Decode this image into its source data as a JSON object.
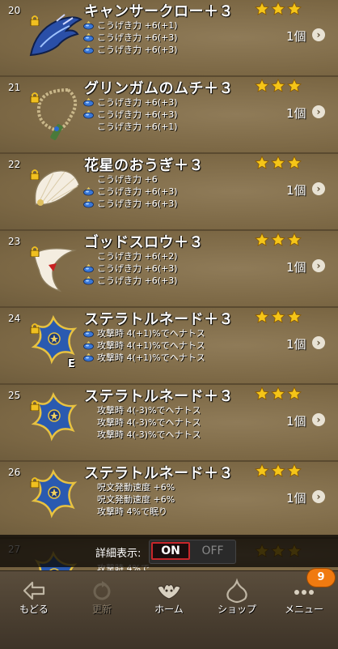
{
  "items": [
    {
      "num": "20",
      "name": "キャンサークロー＋３",
      "qty": "1個",
      "stars": 3,
      "weapon": "claw",
      "stats": [
        {
          "gem": true,
          "text": "こうげき力 +6(+1)"
        },
        {
          "gem": true,
          "text": "こうげき力 +6(+3)"
        },
        {
          "gem": true,
          "text": "こうげき力 +6(+3)"
        }
      ],
      "equipped": false
    },
    {
      "num": "21",
      "name": "グリンガムのムチ＋３",
      "qty": "1個",
      "stars": 3,
      "weapon": "whip",
      "stats": [
        {
          "gem": true,
          "text": "こうげき力 +6(+3)"
        },
        {
          "gem": true,
          "text": "こうげき力 +6(+3)"
        },
        {
          "gem": false,
          "text": "こうげき力 +6(+1)"
        }
      ],
      "equipped": false
    },
    {
      "num": "22",
      "name": "花星のおうぎ＋３",
      "qty": "1個",
      "stars": 3,
      "weapon": "fan",
      "stats": [
        {
          "gem": false,
          "text": "こうげき力 +6"
        },
        {
          "gem": true,
          "text": "こうげき力 +6(+3)"
        },
        {
          "gem": true,
          "text": "こうげき力 +6(+3)"
        }
      ],
      "equipped": false
    },
    {
      "num": "23",
      "name": "ゴッドスロウ＋３",
      "qty": "1個",
      "stars": 3,
      "weapon": "boomerang",
      "stats": [
        {
          "gem": false,
          "text": "こうげき力 +6(+2)"
        },
        {
          "gem": true,
          "text": "こうげき力 +6(+3)"
        },
        {
          "gem": true,
          "text": "こうげき力 +6(+3)"
        }
      ],
      "equipped": false
    },
    {
      "num": "24",
      "name": "ステラトルネード＋３",
      "qty": "1個",
      "stars": 3,
      "weapon": "star",
      "stats": [
        {
          "gem": true,
          "text": "攻撃時 4(+1)%でヘナトス"
        },
        {
          "gem": true,
          "text": "攻撃時 4(+1)%でヘナトス"
        },
        {
          "gem": true,
          "text": "攻撃時 4(+1)%でヘナトス"
        }
      ],
      "equipped": true
    },
    {
      "num": "25",
      "name": "ステラトルネード＋３",
      "qty": "1個",
      "stars": 3,
      "weapon": "star",
      "stats": [
        {
          "gem": false,
          "text": "攻撃時 4(-3)%でヘナトス"
        },
        {
          "gem": false,
          "text": "攻撃時 4(-3)%でヘナトス"
        },
        {
          "gem": false,
          "text": "攻撃時 4(-3)%でヘナトス"
        }
      ],
      "equipped": false
    },
    {
      "num": "26",
      "name": "ステラトルネード＋３",
      "qty": "1個",
      "stars": 3,
      "weapon": "star",
      "stats": [
        {
          "gem": false,
          "text": "呪文発動速度 +6%"
        },
        {
          "gem": false,
          "text": "呪文発動速度 +6%"
        },
        {
          "gem": false,
          "text": "攻撃時 4%で眠り"
        }
      ],
      "equipped": false
    }
  ],
  "partial": {
    "num": "27",
    "stat": "攻撃時 4%で"
  },
  "equipped_mark": "E",
  "chevron": "›",
  "toggle": {
    "label": "詳細表示:",
    "on": "ON",
    "off": "OFF"
  },
  "nav": {
    "back": "もどる",
    "refresh": "更新",
    "home": "ホーム",
    "shop": "ショップ",
    "menu": "メニュー",
    "menu_badge": "9"
  },
  "colors": {
    "star": "#f5c518",
    "accent": "#c8262a",
    "badge": "#f07a10"
  }
}
